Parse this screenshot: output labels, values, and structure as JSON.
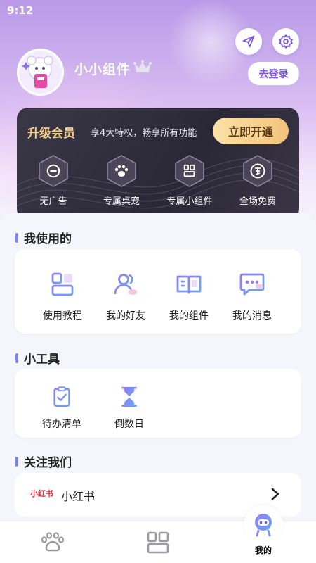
{
  "status_bar": {
    "time": "9:12"
  },
  "profile": {
    "username": "小小组件",
    "login_label": "去登录"
  },
  "vip": {
    "title": "升级会员",
    "subtitle": "享4大特权，畅享所有功能",
    "cta": "立即开通",
    "perks": [
      {
        "label": "无广告",
        "icon": "no-ads-icon"
      },
      {
        "label": "专属桌宠",
        "icon": "paw-icon"
      },
      {
        "label": "专属小组件",
        "icon": "widget-icon"
      },
      {
        "label": "全场免费",
        "icon": "free-icon"
      }
    ]
  },
  "sections": {
    "used": {
      "title": "我使用的",
      "items": [
        {
          "label": "使用教程",
          "icon": "tutorial-icon"
        },
        {
          "label": "我的好友",
          "icon": "friends-icon"
        },
        {
          "label": "我的组件",
          "icon": "book-icon"
        },
        {
          "label": "我的消息",
          "icon": "message-icon"
        }
      ]
    },
    "tools": {
      "title": "小工具",
      "items": [
        {
          "label": "待办清单",
          "icon": "clipboard-check-icon"
        },
        {
          "label": "倒数日",
          "icon": "hourglass-icon"
        }
      ]
    },
    "follow": {
      "title": "关注我们",
      "items": [
        {
          "logo": "小红书",
          "label": "小红书"
        }
      ]
    }
  },
  "tabbar": {
    "tabs": [
      {
        "icon": "paw-icon"
      },
      {
        "icon": "widgets-icon"
      },
      {
        "icon": "robot-icon",
        "label": "我的",
        "active": true
      }
    ]
  },
  "colors": {
    "accent": "#7d86f0",
    "vip_gold": "#f6d08a",
    "login_text": "#7a55e0",
    "brand_red": "#e02b3a"
  }
}
